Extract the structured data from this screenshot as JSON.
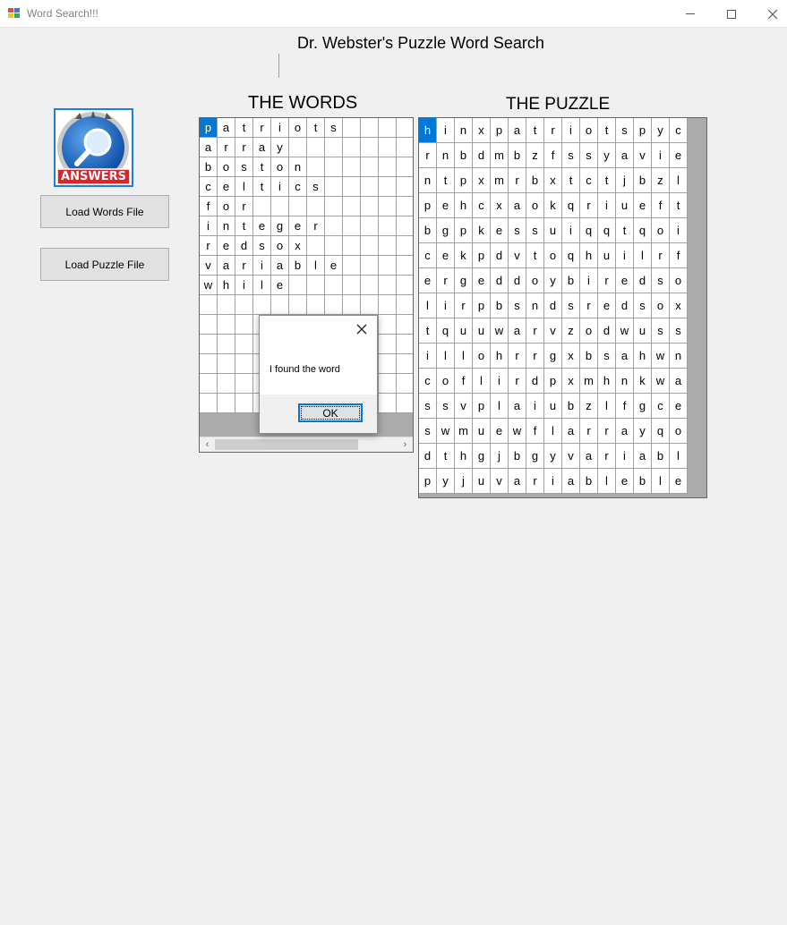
{
  "window": {
    "title": "Word Search!!!"
  },
  "heading": "Dr. Webster's Puzzle Word Search",
  "logo": {
    "text": "ANSWERS",
    "icon": "magnifier-answers-icon"
  },
  "buttons": {
    "load_words": "Load Words File",
    "load_puzzle": "Load Puzzle File"
  },
  "words": {
    "title": "THE WORDS",
    "rows": [
      [
        "p",
        "a",
        "t",
        "r",
        "i",
        "o",
        "t",
        "s",
        "",
        "",
        "",
        ""
      ],
      [
        "a",
        "r",
        "r",
        "a",
        "y",
        "",
        "",
        "",
        "",
        "",
        "",
        ""
      ],
      [
        "b",
        "o",
        "s",
        "t",
        "o",
        "n",
        "",
        "",
        "",
        "",
        "",
        ""
      ],
      [
        "c",
        "e",
        "l",
        "t",
        "i",
        "c",
        "s",
        "",
        "",
        "",
        "",
        ""
      ],
      [
        "f",
        "o",
        "r",
        "",
        "",
        "",
        "",
        "",
        "",
        "",
        "",
        ""
      ],
      [
        "i",
        "n",
        "t",
        "e",
        "g",
        "e",
        "r",
        "",
        "",
        "",
        "",
        ""
      ],
      [
        "r",
        "e",
        "d",
        "s",
        "o",
        "x",
        "",
        "",
        "",
        "",
        "",
        ""
      ],
      [
        "v",
        "a",
        "r",
        "i",
        "a",
        "b",
        "l",
        "e",
        "",
        "",
        "",
        ""
      ],
      [
        "w",
        "h",
        "i",
        "l",
        "e",
        "",
        "",
        "",
        "",
        "",
        "",
        ""
      ],
      [
        "",
        "",
        "",
        "",
        "",
        "",
        "",
        "",
        "",
        "",
        "",
        ""
      ],
      [
        "",
        "",
        "",
        "",
        "",
        "",
        "",
        "",
        "",
        "",
        "",
        ""
      ],
      [
        "",
        "",
        "",
        "",
        "",
        "",
        "",
        "",
        "",
        "",
        "",
        ""
      ],
      [
        "",
        "",
        "",
        "",
        "",
        "",
        "",
        "",
        "",
        "",
        "",
        ""
      ],
      [
        "",
        "",
        "",
        "",
        "",
        "",
        "",
        "",
        "",
        "",
        "",
        ""
      ],
      [
        "",
        "",
        "",
        "",
        "",
        "",
        "",
        "",
        "",
        "",
        "",
        ""
      ]
    ]
  },
  "puzzle": {
    "title": "THE PUZZLE",
    "rows": [
      [
        "h",
        "i",
        "n",
        "x",
        "p",
        "a",
        "t",
        "r",
        "i",
        "o",
        "t",
        "s",
        "p",
        "y",
        "c"
      ],
      [
        "r",
        "n",
        "b",
        "d",
        "m",
        "b",
        "z",
        "f",
        "s",
        "s",
        "y",
        "a",
        "v",
        "i",
        "e"
      ],
      [
        "n",
        "t",
        "p",
        "x",
        "m",
        "r",
        "b",
        "x",
        "t",
        "c",
        "t",
        "j",
        "b",
        "z",
        "l"
      ],
      [
        "p",
        "e",
        "h",
        "c",
        "x",
        "a",
        "o",
        "k",
        "q",
        "r",
        "i",
        "u",
        "e",
        "f",
        "t"
      ],
      [
        "b",
        "g",
        "p",
        "k",
        "e",
        "s",
        "s",
        "u",
        "i",
        "q",
        "q",
        "t",
        "q",
        "o",
        "i"
      ],
      [
        "c",
        "e",
        "k",
        "p",
        "d",
        "v",
        "t",
        "o",
        "q",
        "h",
        "u",
        "i",
        "l",
        "r",
        "f"
      ],
      [
        "e",
        "r",
        "g",
        "e",
        "d",
        "d",
        "o",
        "y",
        "b",
        "i",
        "r",
        "e",
        "d",
        "s",
        "o"
      ],
      [
        "l",
        "i",
        "r",
        "p",
        "b",
        "s",
        "n",
        "d",
        "s",
        "r",
        "e",
        "d",
        "s",
        "o",
        "x"
      ],
      [
        "t",
        "q",
        "u",
        "u",
        "w",
        "a",
        "r",
        "v",
        "z",
        "o",
        "d",
        "w",
        "u",
        "s",
        "s"
      ],
      [
        "i",
        "l",
        "l",
        "o",
        "h",
        "r",
        "r",
        "g",
        "x",
        "b",
        "s",
        "a",
        "h",
        "w",
        "n"
      ],
      [
        "c",
        "o",
        "f",
        "l",
        "i",
        "r",
        "d",
        "p",
        "x",
        "m",
        "h",
        "n",
        "k",
        "w",
        "a"
      ],
      [
        "s",
        "s",
        "v",
        "p",
        "l",
        "a",
        "i",
        "u",
        "b",
        "z",
        "l",
        "f",
        "g",
        "c",
        "e"
      ],
      [
        "s",
        "w",
        "m",
        "u",
        "e",
        "w",
        "f",
        "l",
        "a",
        "r",
        "r",
        "a",
        "y",
        "q",
        "o"
      ],
      [
        "d",
        "t",
        "h",
        "g",
        "j",
        "b",
        "g",
        "y",
        "v",
        "a",
        "r",
        "i",
        "a",
        "b",
        "l"
      ],
      [
        "p",
        "y",
        "j",
        "u",
        "v",
        "a",
        "r",
        "i",
        "a",
        "b",
        "l",
        "e",
        "b",
        "l",
        "e"
      ]
    ]
  },
  "dialog": {
    "message": "I found the word",
    "ok_label": "OK"
  },
  "colors": {
    "selection": "#0078d7",
    "panel_gray": "#ababab",
    "logo_red": "#d9262b",
    "logo_blue": "#1e6fc8"
  }
}
